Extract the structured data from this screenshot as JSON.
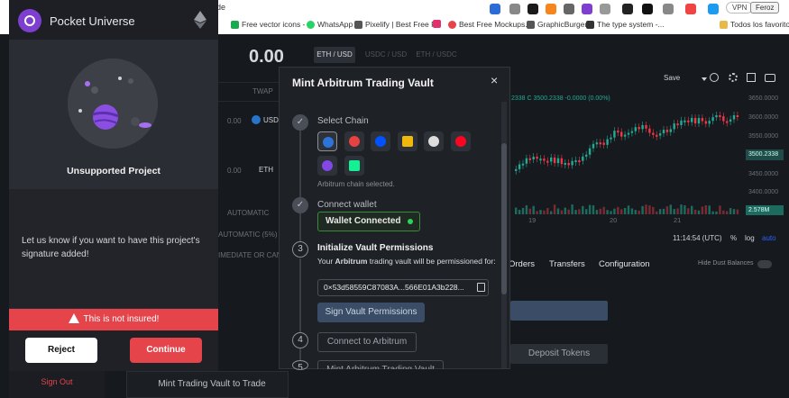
{
  "browser": {
    "address_fragment": "rade",
    "bookmarks": [
      {
        "label": "Free vector icons -",
        "color": "#1aa851"
      },
      {
        "label": "WhatsApp",
        "color": "#25d366"
      },
      {
        "label": "Pixelify | Best Free F...",
        "color": "#555555"
      },
      {
        "label": "",
        "color": "#e1306c"
      },
      {
        "label": "Best Free Mockups...",
        "color": "#e4444a"
      },
      {
        "label": "GraphicBurger",
        "color": "#555555"
      },
      {
        "label": "The type system -...",
        "color": "#333333"
      },
      {
        "label": "Todos los favoritos",
        "color": "#e8b84a"
      }
    ],
    "vpn_label": "VPN",
    "profile_label": "Feroz"
  },
  "app": {
    "price": "0.00",
    "pair_tabs": [
      "ETH / USD",
      "USDC / USD",
      "ETH / USDC"
    ],
    "twap_label": "TWAP",
    "rows": [
      {
        "value": "0.00",
        "asset": "USD"
      },
      {
        "value": "0.00",
        "asset": "ETH"
      }
    ],
    "order_labels": [
      "AUTOMATIC",
      "AUTOMATIC (5%)",
      "IMEDIATE OR CANCE"
    ],
    "chart_toolbar": {
      "save": "Save"
    },
    "ohlc_text": "2338 C 3500.2338 -0.0000 (0.00%)",
    "price_ticks": [
      "3650.0000",
      "3600.0000",
      "3550.0000",
      "3450.0000",
      "3400.0000"
    ],
    "current_price_tag": "3500.2338",
    "volume_tag": "2.578M",
    "date_ticks": [
      "19",
      "20",
      "21"
    ],
    "time_label": "11:14:54 (UTC)",
    "scale_pct": "%",
    "scale_log": "log",
    "scale_auto": "auto",
    "bottom_tabs": [
      "Orders",
      "Transfers",
      "Configuration"
    ],
    "hide_dust": "Hide Dust Balances",
    "deposit_tokens": "Deposit Tokens",
    "mint_trade_button": "Mint Trading Vault to Trade"
  },
  "pocket_universe": {
    "title": "Pocket Universe",
    "status": "Unsupported Project",
    "message": "Let us know if you want to have this project's signature added!",
    "warning": "This is not insured!",
    "reject": "Reject",
    "continue": "Continue",
    "sign_out": "Sign Out"
  },
  "modal": {
    "title": "Mint Arbitrum Trading Vault",
    "close": "×",
    "steps": [
      {
        "label": "Select Chain",
        "state": "done"
      },
      {
        "label": "Connect wallet",
        "state": "done"
      },
      {
        "number": "3",
        "label": "Initialize Vault Permissions",
        "state": "active"
      },
      {
        "number": "4",
        "label": "",
        "state": "pending"
      },
      {
        "number": "5",
        "label": "",
        "state": "pending"
      }
    ],
    "chain_note": "Arbitrum chain selected.",
    "chains": [
      {
        "name": "arbitrum",
        "color": "#2d74da"
      },
      {
        "name": "avalanche",
        "color": "#e84142"
      },
      {
        "name": "base",
        "color": "#0052ff"
      },
      {
        "name": "bnb",
        "color": "#f0b90b"
      },
      {
        "name": "ethereum",
        "color": "#dddddd"
      },
      {
        "name": "optimism",
        "color": "#ff0420"
      },
      {
        "name": "polygon",
        "color": "#8247e5"
      },
      {
        "name": "solana",
        "color": "#14f195"
      }
    ],
    "wallet_connected": "Wallet Connected",
    "perm_prefix": "Your ",
    "perm_bold": "Arbitrum",
    "perm_suffix": " trading vault will be permissioned for:",
    "address": "0×53d58559C87083A...566E01A3b228...",
    "sign_button": "Sign Vault Permissions",
    "connect_button": "Connect to Arbitrum",
    "mint_button": "Mint Arbitrum Trading Vault"
  }
}
